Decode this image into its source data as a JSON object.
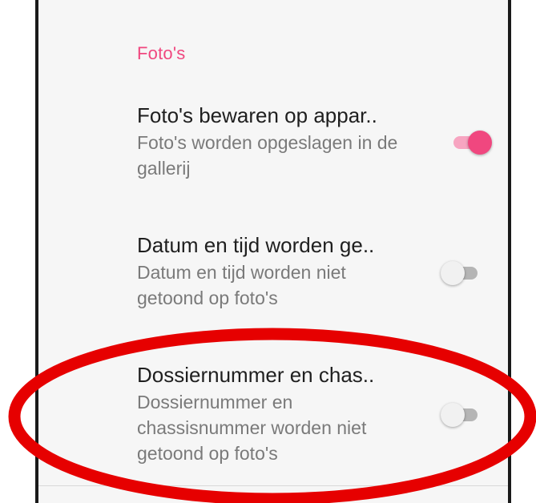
{
  "section": {
    "header": "Foto's"
  },
  "settings": [
    {
      "title": "Foto's bewaren op appar..",
      "summary": "Foto's worden opgeslagen in de gallerij",
      "enabled": true
    },
    {
      "title": "Datum en tijd worden ge..",
      "summary": "Datum en tijd worden niet getoond op foto's",
      "enabled": false
    },
    {
      "title": "Dossiernummer en chas..",
      "summary": "Dossiernummer en chassisnummer worden niet getoond op foto's",
      "enabled": false
    }
  ],
  "colors": {
    "accent": "#f0477f",
    "accent_track": "#f7a5c1",
    "annotation": "#e60000",
    "background": "#f6f6f6"
  }
}
